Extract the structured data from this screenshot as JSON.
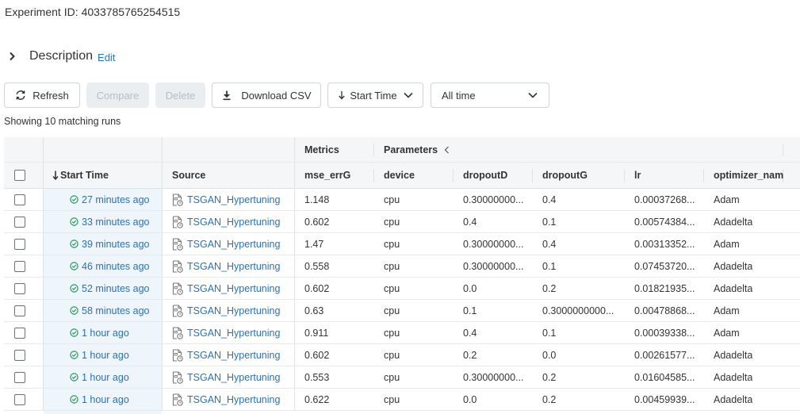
{
  "experiment": {
    "label": "Experiment ID:",
    "id": "4033785765254515"
  },
  "description": {
    "title": "Description",
    "edit": "Edit"
  },
  "toolbar": {
    "refresh": "Refresh",
    "compare": "Compare",
    "delete": "Delete",
    "download": "Download CSV",
    "sort": "Start Time",
    "time_filter": "All time"
  },
  "showing": "Showing 10 matching runs",
  "table": {
    "groups": {
      "metrics": "Metrics",
      "parameters": "Parameters"
    },
    "columns": {
      "start_time": "Start Time",
      "source": "Source",
      "mse_errG": "mse_errG",
      "device": "device",
      "dropoutD": "dropoutD",
      "dropoutG": "dropoutG",
      "lr": "lr",
      "optimizer": "optimizer_name"
    },
    "rows": [
      {
        "time": "27 minutes ago",
        "source": "TSGAN_Hypertuning",
        "mse": "1.148",
        "device": "cpu",
        "dropoutD": "0.30000000...",
        "dropoutG": "0.4",
        "lr": "0.00037268...",
        "optimizer": "Adam"
      },
      {
        "time": "33 minutes ago",
        "source": "TSGAN_Hypertuning",
        "mse": "0.602",
        "device": "cpu",
        "dropoutD": "0.4",
        "dropoutG": "0.1",
        "lr": "0.00574384...",
        "optimizer": "Adadelta"
      },
      {
        "time": "39 minutes ago",
        "source": "TSGAN_Hypertuning",
        "mse": "1.47",
        "device": "cpu",
        "dropoutD": "0.30000000...",
        "dropoutG": "0.4",
        "lr": "0.00313352...",
        "optimizer": "Adam"
      },
      {
        "time": "46 minutes ago",
        "source": "TSGAN_Hypertuning",
        "mse": "0.558",
        "device": "cpu",
        "dropoutD": "0.30000000...",
        "dropoutG": "0.1",
        "lr": "0.07453720...",
        "optimizer": "Adadelta"
      },
      {
        "time": "52 minutes ago",
        "source": "TSGAN_Hypertuning",
        "mse": "0.602",
        "device": "cpu",
        "dropoutD": "0.0",
        "dropoutG": "0.2",
        "lr": "0.01821935...",
        "optimizer": "Adadelta"
      },
      {
        "time": "58 minutes ago",
        "source": "TSGAN_Hypertuning",
        "mse": "0.63",
        "device": "cpu",
        "dropoutD": "0.1",
        "dropoutG": "0.3000000000...",
        "lr": "0.00478868...",
        "optimizer": "Adam"
      },
      {
        "time": "1 hour ago",
        "source": "TSGAN_Hypertuning",
        "mse": "0.911",
        "device": "cpu",
        "dropoutD": "0.4",
        "dropoutG": "0.1",
        "lr": "0.00039338...",
        "optimizer": "Adam"
      },
      {
        "time": "1 hour ago",
        "source": "TSGAN_Hypertuning",
        "mse": "0.602",
        "device": "cpu",
        "dropoutD": "0.2",
        "dropoutG": "0.0",
        "lr": "0.00261577...",
        "optimizer": "Adadelta"
      },
      {
        "time": "1 hour ago",
        "source": "TSGAN_Hypertuning",
        "mse": "0.553",
        "device": "cpu",
        "dropoutD": "0.30000000...",
        "dropoutG": "0.2",
        "lr": "0.01604585...",
        "optimizer": "Adadelta"
      },
      {
        "time": "1 hour ago",
        "source": "TSGAN_Hypertuning",
        "mse": "0.622",
        "device": "cpu",
        "dropoutD": "0.0",
        "dropoutG": "0.2",
        "lr": "0.00459939...",
        "optimizer": "Adadelta"
      }
    ]
  },
  "colors": {
    "link": "#2374bb",
    "success": "#1f9d55",
    "header_bg": "#f4f6f8",
    "sorted_col_bg": "#eef5fb"
  },
  "icons": {
    "refresh": "refresh-icon",
    "download": "download-icon",
    "sort": "arrow-down-icon",
    "status": "check-circle-icon",
    "source": "notebook-icon"
  }
}
